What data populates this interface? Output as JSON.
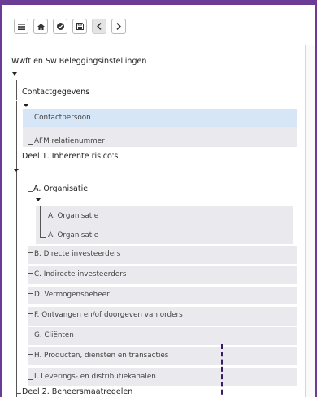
{
  "toolbar": {
    "buttons": [
      {
        "name": "menu",
        "icon": "hamburger-icon"
      },
      {
        "name": "home",
        "icon": "home-icon"
      },
      {
        "name": "check",
        "icon": "check-circle-icon"
      },
      {
        "name": "save",
        "icon": "save-icon"
      },
      {
        "name": "back",
        "icon": "chevron-left-icon"
      },
      {
        "name": "forward",
        "icon": "chevron-right-icon"
      }
    ]
  },
  "tree": {
    "root": "Wwft en Sw Beleggingsinstellingen",
    "contact": {
      "label": "Contactgegevens",
      "items": [
        "Contactpersoon",
        "AFM relatienummer"
      ]
    },
    "deel1": {
      "label": "Deel 1. Inherente risico's",
      "organisatie": {
        "label": "A. Organisatie",
        "items": [
          "A. Organisatie",
          "A. Organisatie"
        ]
      },
      "items": [
        "B. Directe investeerders",
        "C. Indirecte investeerders",
        "D. Vermogensbeheer",
        "F. Ontvangen en/of doorgeven van orders",
        "G. Cliënten",
        "H. Producten, diensten en transacties",
        "I. Leverings- en distributiekanalen"
      ]
    },
    "deel2": {
      "label": "Deel 2. Beheersmaatregelen"
    }
  },
  "colors": {
    "frame": "#6a3c96",
    "selected": "#d7e6f6",
    "row": "#e9e9ee",
    "dashed": "#3a1a64"
  }
}
